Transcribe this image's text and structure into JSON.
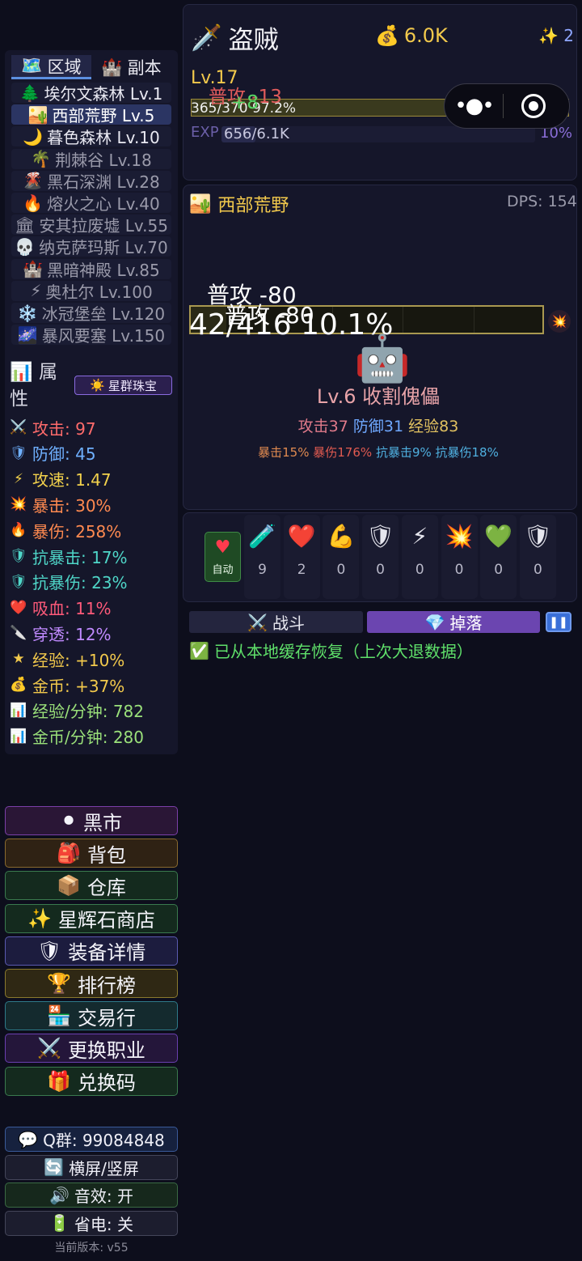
{
  "tabs": {
    "zone_tab": "区域",
    "dungeon_tab": "副本"
  },
  "zones": [
    {
      "icon": "🌲",
      "name": "埃尔文森林 Lv.1",
      "state": "open"
    },
    {
      "icon": "🏜️",
      "name": "西部荒野 Lv.5",
      "state": "selected"
    },
    {
      "icon": "🌙",
      "name": "暮色森林 Lv.10",
      "state": "open"
    },
    {
      "icon": "🌴",
      "name": "荆棘谷 Lv.18",
      "state": "locked"
    },
    {
      "icon": "🌋",
      "name": "黑石深渊 Lv.28",
      "state": "locked"
    },
    {
      "icon": "🔥",
      "name": "熔火之心 Lv.40",
      "state": "locked"
    },
    {
      "icon": "🏛",
      "name": "安其拉废墟 Lv.55",
      "state": "locked"
    },
    {
      "icon": "💀",
      "name": "纳克萨玛斯 Lv.70",
      "state": "locked"
    },
    {
      "icon": "🏰",
      "name": "黑暗神殿 Lv.85",
      "state": "locked"
    },
    {
      "icon": "⚡",
      "name": "奥杜尔 Lv.100",
      "state": "locked"
    },
    {
      "icon": "❄️",
      "name": "冰冠堡垒 Lv.120",
      "state": "locked"
    },
    {
      "icon": "🌌",
      "name": "暴风要塞 Lv.150",
      "state": "locked"
    }
  ],
  "attributes": {
    "title": "属性",
    "gem_button": "星群珠宝",
    "stats": [
      {
        "icon": "⚔️",
        "text": "攻击: 97",
        "color": "#ff6b6b"
      },
      {
        "icon": "🛡",
        "text": "防御: 45",
        "color": "#6fb0ff"
      },
      {
        "icon": "⚡",
        "text": "攻速: 1.47",
        "color": "#f2d14c"
      },
      {
        "icon": "💥",
        "text": "暴击: 30%",
        "color": "#ff8a50"
      },
      {
        "icon": "🔥",
        "text": "暴伤: 258%",
        "color": "#ff8a50"
      },
      {
        "icon": "🛡",
        "text": "抗暴击: 17%",
        "color": "#4fd6c8"
      },
      {
        "icon": "🛡",
        "text": "抗暴伤: 23%",
        "color": "#4fd6c8"
      },
      {
        "icon": "❤️",
        "text": "吸血: 11%",
        "color": "#ff5a7a"
      },
      {
        "icon": "🔪",
        "text": "穿透: 12%",
        "color": "#c08aff"
      },
      {
        "icon": "★",
        "text": "经验: +10%",
        "color": "#f2c94c"
      },
      {
        "icon": "💰",
        "text": "金币: +37%",
        "color": "#f2c94c"
      },
      {
        "icon": "📊",
        "text": "经验/分钟: 782",
        "color": "#9ae07a"
      },
      {
        "icon": "📊",
        "text": "金币/分钟: 280",
        "color": "#9ae07a"
      }
    ]
  },
  "menu": [
    {
      "icon": "⚫",
      "label": "黑市",
      "bg": "#2a1636",
      "border": "#7b3fa8"
    },
    {
      "icon": "🎒",
      "label": "背包",
      "bg": "#2f2214",
      "border": "#8a6a2e"
    },
    {
      "icon": "📦",
      "label": "仓库",
      "bg": "#142a1e",
      "border": "#3a7a4e"
    },
    {
      "icon": "✨",
      "label": "星辉石商店",
      "bg": "#142a1e",
      "border": "#3a7a4e"
    },
    {
      "icon": "🛡",
      "label": "装备详情",
      "bg": "#1c1c3e",
      "border": "#5a5ab0"
    },
    {
      "icon": "🏆",
      "label": "排行榜",
      "bg": "#2f2814",
      "border": "#8a7a2e"
    },
    {
      "icon": "🏪",
      "label": "交易行",
      "bg": "#142a2e",
      "border": "#2e7a8a"
    },
    {
      "icon": "⚔️",
      "label": "更换职业",
      "bg": "#24163a",
      "border": "#6a3fb0"
    },
    {
      "icon": "🎁",
      "label": "兑换码",
      "bg": "#142a1e",
      "border": "#3a7a4e"
    }
  ],
  "utility": [
    {
      "icon": "💬",
      "label": "Q群: 99084848",
      "bg": "#16213e",
      "border": "#3a5a9a"
    },
    {
      "icon": "🔄",
      "label": "横屏/竖屏",
      "bg": "#1c1d2e",
      "border": "#44465a"
    },
    {
      "icon": "🔊",
      "label": "音效: 开",
      "bg": "#16281c",
      "border": "#3a6a44"
    },
    {
      "icon": "🔋",
      "label": "省电: 关",
      "bg": "#1c1d2e",
      "border": "#44465a"
    }
  ],
  "version": "当前版本: v55",
  "character": {
    "icon": "🗡️",
    "name": "盗贼",
    "gold": "6.0K",
    "stars": "✨ 2",
    "level": "Lv.17",
    "hp_text": "365/370 97.2%",
    "hp_fraction": 0.972,
    "float_damage": "普攻 -13",
    "float_heal": "+8",
    "exp_label": "EXP",
    "exp_text": "656/6.1K",
    "exp_percent": "10%",
    "exp_fraction": 0.107
  },
  "battle": {
    "area_icon": "🏜️",
    "area_name": "西部荒野",
    "dps": "DPS: 154",
    "float_damage_1": "普攻 -80",
    "float_damage_2": "普攻 -80",
    "monster_hp": "42/416  10.1%",
    "monster_hp_fraction": 0.101,
    "monster_icon": "🤖",
    "monster_name": "Lv.6 收割傀儡",
    "attack": "攻击37",
    "defense": "防御31",
    "exp": "经验83",
    "crit": "暴击15%",
    "crit_dmg": "暴伤176%",
    "anti_crit": "抗暴击9%",
    "anti_crit_dmg": "抗暴伤18%"
  },
  "potions": {
    "auto_label": "自动",
    "slots": [
      {
        "icon": "🧪",
        "count": "9"
      },
      {
        "icon": "❤️",
        "count": "2"
      },
      {
        "icon": "💪",
        "count": "0"
      },
      {
        "icon": "🛡",
        "count": "0"
      },
      {
        "icon": "⚡",
        "count": "0"
      },
      {
        "icon": "💥",
        "count": "0"
      },
      {
        "icon": "💚",
        "count": "0"
      },
      {
        "icon": "🛡",
        "count": "0"
      }
    ]
  },
  "bottom_tabs": {
    "battle": "战斗",
    "drops": "掉落"
  },
  "notice": "已从本地缓存恢复（上次大退数据）"
}
